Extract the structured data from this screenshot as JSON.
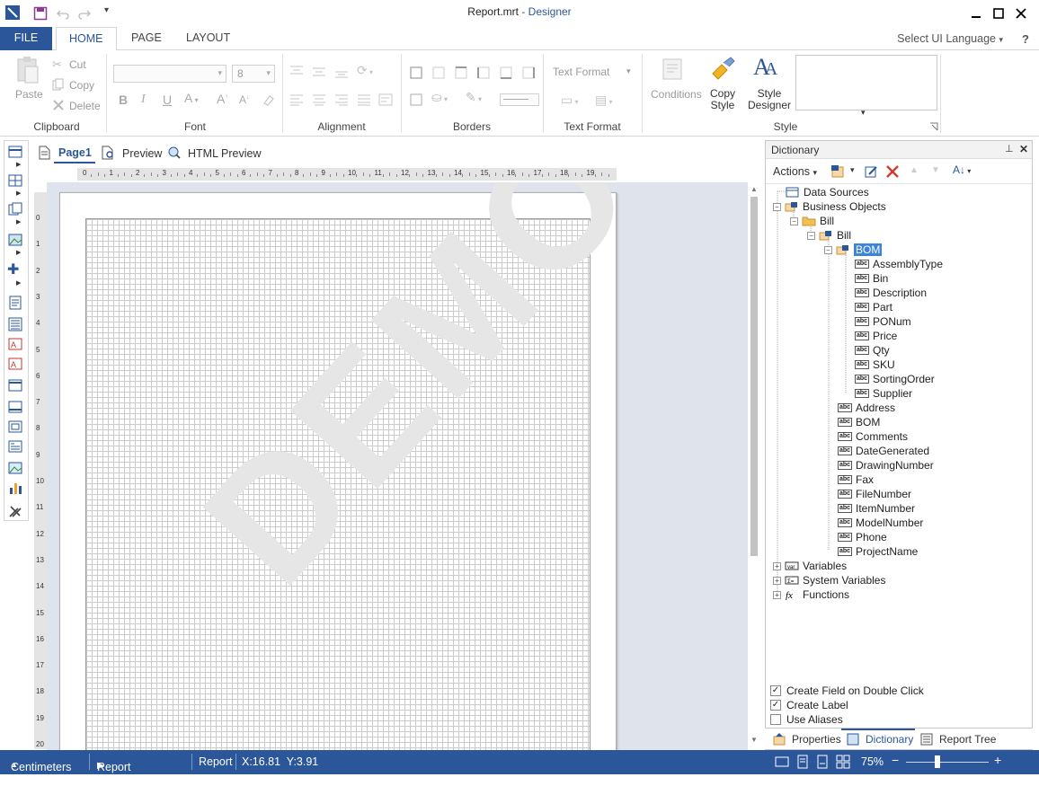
{
  "window": {
    "file_name": "Report.mrt",
    "app_name": "- Designer"
  },
  "ribbon_tabs": [
    "FILE",
    "HOME",
    "PAGE",
    "LAYOUT"
  ],
  "language_select": "Select UI Language",
  "help": "?",
  "clipboard": {
    "paste": "Paste",
    "cut": "Cut",
    "copy": "Copy",
    "delete": "Delete",
    "label": "Clipboard"
  },
  "font": {
    "size": "8",
    "label": "Font"
  },
  "alignment": {
    "label": "Alignment"
  },
  "borders": {
    "label": "Borders"
  },
  "text_format": {
    "combo": "Text Format",
    "label": "Text Format"
  },
  "style": {
    "conditions": "Conditions",
    "copy_style_1": "Copy",
    "copy_style_2": "Style",
    "style_designer_1": "Style",
    "style_designer_2": "Designer",
    "label": "Style"
  },
  "page_tabs": {
    "page1": "Page1",
    "preview": "Preview",
    "html_preview": "HTML Preview"
  },
  "hruler_ticks": [
    "0",
    "1",
    "2",
    "3",
    "4",
    "5",
    "6",
    "7",
    "8",
    "9",
    "10",
    "11",
    "12",
    "13",
    "14",
    "15",
    "16",
    "17",
    "18",
    "19"
  ],
  "vruler_ticks": [
    "0",
    "1",
    "2",
    "3",
    "4",
    "5",
    "6",
    "7",
    "8",
    "9",
    "10",
    "11",
    "12",
    "13",
    "14",
    "15",
    "16",
    "17",
    "18",
    "19",
    "20"
  ],
  "watermark": "DEMO",
  "dictionary": {
    "title": "Dictionary",
    "actions": "Actions",
    "tree": {
      "data_sources": "Data Sources",
      "business_objects": "Business Objects",
      "bill_folder": "Bill",
      "bill_object": "Bill",
      "bom_object": "BOM",
      "bom_fields": [
        "AssemblyType",
        "Bin",
        "Description",
        "Part",
        "PONum",
        "Price",
        "Qty",
        "SKU",
        "SortingOrder",
        "Supplier"
      ],
      "bill_fields": [
        "Address",
        "BOM",
        "Comments",
        "DateGenerated",
        "DrawingNumber",
        "Fax",
        "FileNumber",
        "ItemNumber",
        "ModelNumber",
        "Phone",
        "ProjectName"
      ],
      "variables": "Variables",
      "system_variables": "System Variables",
      "functions": "Functions"
    },
    "options": [
      {
        "label": "Create Field on Double Click",
        "checked": true
      },
      {
        "label": "Create Label",
        "checked": true
      },
      {
        "label": "Use Aliases",
        "checked": false
      }
    ],
    "bottom_tabs": [
      "Properties",
      "Dictionary",
      "Report Tree"
    ]
  },
  "status": {
    "units": "Centimeters",
    "checker": "Report Checker",
    "report": "Report",
    "coords": "X:16.81  Y:3.91",
    "zoom": "75%"
  },
  "colors": {
    "accent": "#2b579a",
    "selection": "#3b84d9"
  }
}
